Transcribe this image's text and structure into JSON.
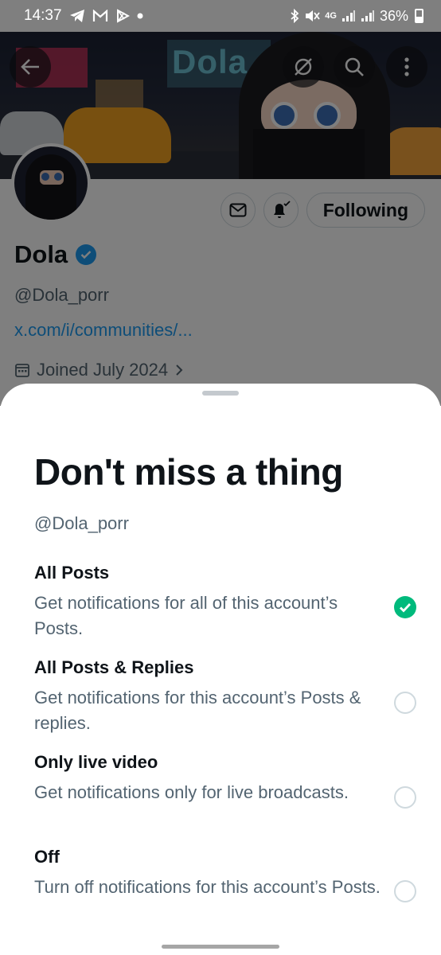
{
  "status_bar": {
    "time": "14:37",
    "network": "4G",
    "battery": "36%"
  },
  "profile": {
    "banner_text": "Dola",
    "name": "Dola",
    "handle": "@Dola_porr",
    "link": "x.com/i/communities/...",
    "joined": "Joined July 2024",
    "following_label": "Following"
  },
  "sheet": {
    "title": "Don't miss a thing",
    "handle": "@Dola_porr",
    "options": [
      {
        "title": "All Posts",
        "desc": "Get notifications for all of this account’s Posts.",
        "selected": true
      },
      {
        "title": "All Posts & Replies",
        "desc": "Get notifications for this account’s Posts & replies.",
        "selected": false
      },
      {
        "title": "Only live video",
        "desc": "Get notifications only for live broadcasts.",
        "selected": false
      },
      {
        "title": "Off",
        "desc": "Turn off notifications for this account’s Posts.",
        "selected": false
      }
    ]
  },
  "colors": {
    "accent": "#1d9bf0",
    "selected": "#00ba7c",
    "text_primary": "#0f1419",
    "text_secondary": "#536471"
  }
}
